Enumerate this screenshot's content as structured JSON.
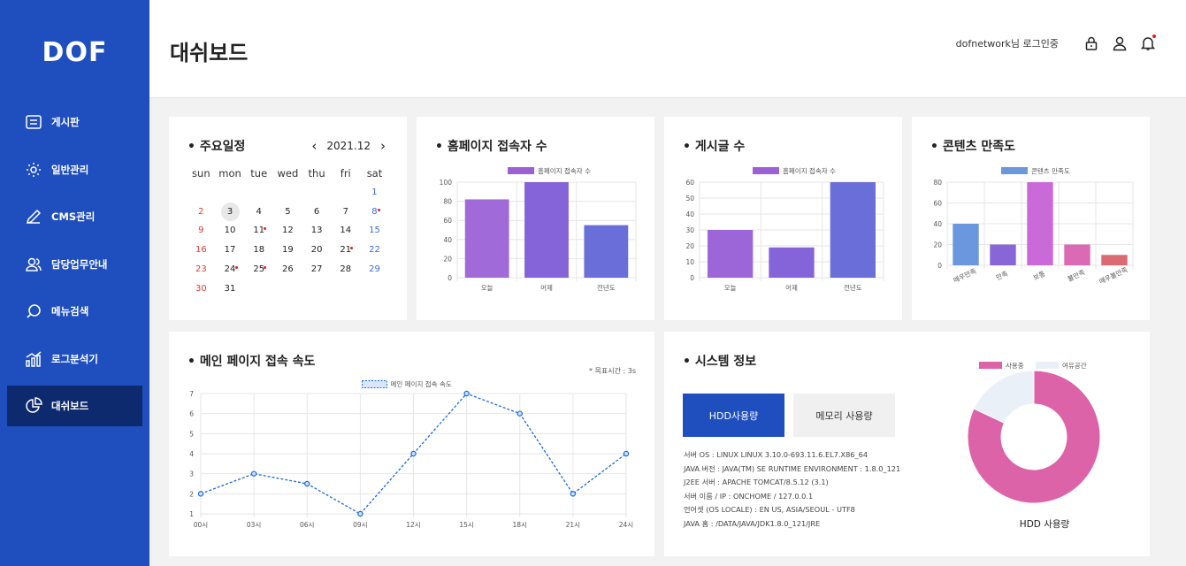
{
  "app": {
    "logo": "DOF"
  },
  "sidebar": {
    "items": [
      {
        "label": "게시판"
      },
      {
        "label": "일반관리"
      },
      {
        "label": "CMS관리"
      },
      {
        "label": "담당업무안내"
      },
      {
        "label": "메뉴검색"
      },
      {
        "label": "로그분석기"
      },
      {
        "label": "대쉬보드",
        "active": true
      }
    ]
  },
  "header": {
    "title": "대쉬보드",
    "user_text": "dofnetwork님 로그인중"
  },
  "calendar": {
    "title": "주요일정",
    "month": "2021.12",
    "prev": "‹",
    "next": "›",
    "weekdays": [
      "sun",
      "mon",
      "tue",
      "wed",
      "thu",
      "fri",
      "sat"
    ],
    "weeks": [
      [
        "",
        "",
        "",
        "",
        "",
        "",
        "1"
      ],
      [
        "2",
        "3",
        "4",
        "5",
        "6",
        "7",
        "8"
      ],
      [
        "9",
        "10",
        "11",
        "12",
        "13",
        "14",
        "15"
      ],
      [
        "16",
        "17",
        "18",
        "19",
        "20",
        "21",
        "22"
      ],
      [
        "23",
        "24",
        "25",
        "26",
        "27",
        "28",
        "29"
      ],
      [
        "30",
        "31",
        "",
        "",
        "",
        "",
        ""
      ]
    ],
    "today": "3",
    "event_days": [
      "8",
      "11",
      "21",
      "24",
      "25"
    ]
  },
  "visitors": {
    "title": "홈페이지 접속자 수"
  },
  "posts": {
    "title": "게시글 수"
  },
  "satisfaction": {
    "title": "콘텐츠 만족도"
  },
  "speed": {
    "title": "메인 페이지 접속 속도",
    "note": "* 목표시간 : 3s"
  },
  "system": {
    "title": "시스템 정보",
    "btn_hdd": "HDD사용량",
    "btn_mem": "메모리 사용량",
    "info": [
      "서버 OS : LINUX LINUX 3.10.0-693.11.6.EL7.X86_64",
      "JAVA 버전 : JAVA(TM) SE RUNTIME ENVIRONMENT : 1.8.0_121",
      "J2EE 서버 : APACHE TOMCAT/8.5.12 (3.1)",
      "서버 이름 / IP : ONCHOME / 127.0.0.1",
      "언어셋 (OS LOCALE) : EN US, ASIA/SEOUL - UTF8",
      "JAVA 홈 : /DATA/JAVA/JDK1.8.0_121/JRE"
    ],
    "donut_label": "HDD 사용량"
  },
  "chart_data": [
    {
      "id": "visitors",
      "type": "bar",
      "categories": [
        "오늘",
        "어제",
        "전년도"
      ],
      "series": [
        {
          "name": "홈페이지 접속자 수",
          "values": [
            82,
            100,
            55
          ]
        }
      ],
      "ylim": [
        0,
        100
      ],
      "yticks": [
        0,
        20,
        40,
        60,
        80,
        100
      ],
      "colors": [
        "#a06ad8",
        "#8563d8",
        "#6a6ed8"
      ],
      "legend_color": "#9b5fd6",
      "legend": "top"
    },
    {
      "id": "posts",
      "type": "bar",
      "categories": [
        "오늘",
        "어제",
        "전년도"
      ],
      "series": [
        {
          "name": "홈페이지 접속자 수",
          "values": [
            30,
            19,
            60
          ]
        }
      ],
      "ylim": [
        0,
        60
      ],
      "yticks": [
        0,
        10,
        20,
        30,
        40,
        50,
        60
      ],
      "colors": [
        "#9d66d8",
        "#8563d8",
        "#6a6ed8"
      ],
      "legend_color": "#9b5fd6",
      "legend": "top"
    },
    {
      "id": "satisfaction",
      "type": "bar",
      "categories": [
        "매우만족",
        "만족",
        "보통",
        "불만족",
        "매우불만족"
      ],
      "series": [
        {
          "name": "콘텐츠 만족도",
          "values": [
            40,
            20,
            80,
            20,
            10
          ]
        }
      ],
      "ylim": [
        0,
        80
      ],
      "yticks": [
        0,
        20,
        40,
        60,
        80
      ],
      "colors": [
        "#6a97dd",
        "#8866d8",
        "#c96ad8",
        "#db6ab4",
        "#dc6a72"
      ],
      "legend_color": "#6a97dd",
      "legend": "top"
    },
    {
      "id": "speed",
      "type": "line",
      "x": [
        "00시",
        "03시",
        "06시",
        "09시",
        "12시",
        "15시",
        "18시",
        "21시",
        "24시"
      ],
      "series": [
        {
          "name": "메인 페이지 접속 속도",
          "values": [
            2,
            3,
            2.5,
            1,
            4,
            7,
            6,
            2,
            4
          ]
        }
      ],
      "ylim": [
        1,
        7
      ],
      "yticks": [
        1,
        2,
        3,
        4,
        5,
        6,
        7
      ],
      "color": "#1a6ae0",
      "line_style": "dashed",
      "legend": "top"
    },
    {
      "id": "hdd",
      "type": "pie",
      "donut": true,
      "slices": [
        {
          "name": "사용중",
          "value": 82,
          "color": "#dd63a8"
        },
        {
          "name": "여유공간",
          "value": 18,
          "color": "#eaf0f8"
        }
      ],
      "legend": "top"
    }
  ]
}
